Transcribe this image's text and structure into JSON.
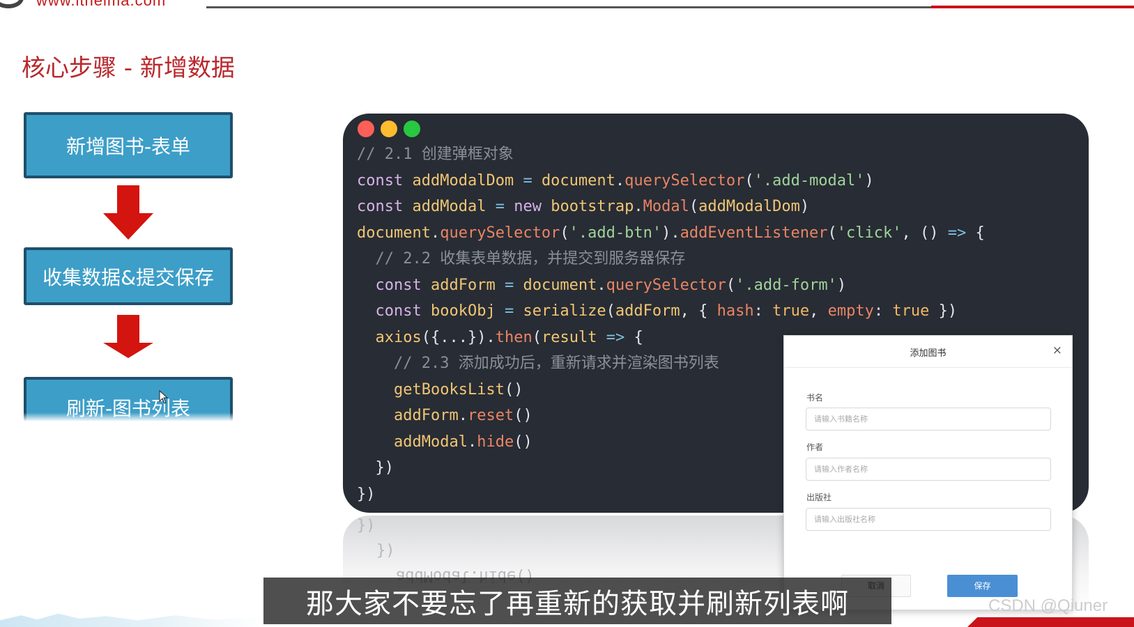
{
  "header": {
    "logo_url": "www.itheima.com"
  },
  "page_title": "核心步骤 - 新增数据",
  "steps": [
    "新增图书-表单",
    "收集数据&提交保存",
    "刷新-图书列表"
  ],
  "code_window": {
    "window_controls": [
      "red",
      "yellow",
      "green"
    ],
    "lines": [
      "// 2.1 创建弹框对象",
      "const addModalDom = document.querySelector('.add-modal')",
      "const addModal = new bootstrap.Modal(addModalDom)",
      "document.querySelector('.add-btn').addEventListener('click', () => {",
      "  // 2.2 收集表单数据，并提交到服务器保存",
      "  const addForm = document.querySelector('.add-form')",
      "  const bookObj = serialize(addForm, { hash: true, empty: true })",
      "  axios({...}).then(result => {",
      "    // 2.3 添加成功后，重新请求并渲染图书列表",
      "    getBooksList()",
      "    addForm.reset()",
      "    addModal.hide()",
      "  })",
      "})"
    ]
  },
  "modal": {
    "title": "添加图书",
    "close_symbol": "×",
    "fields": [
      {
        "label": "书名",
        "placeholder": "请输入书籍名称"
      },
      {
        "label": "作者",
        "placeholder": "请输入作者名称"
      },
      {
        "label": "出版社",
        "placeholder": "请输入出版社名称"
      }
    ],
    "cancel_label": "取消",
    "save_label": "保存"
  },
  "subtitle": "那大家不要忘了再重新的获取并刷新列表啊",
  "watermark": "CSDN @Qiuner",
  "colors": {
    "title_red": "#b8292d",
    "step_blue": "#3d9ec8",
    "arrow_red": "#d3140f",
    "code_bg": "#282c34",
    "save_blue": "#4a8fd4"
  }
}
